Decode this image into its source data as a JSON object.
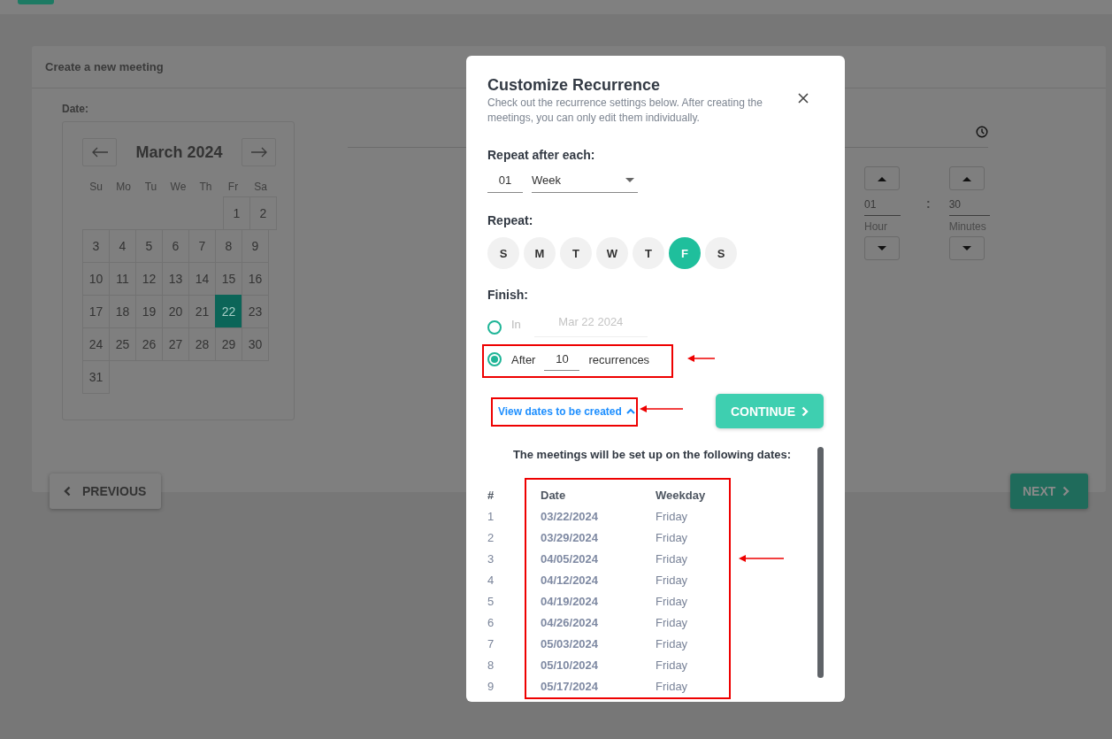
{
  "page": {
    "title": "Create a new meeting",
    "date_label": "Date:",
    "calendar": {
      "month": "March 2024",
      "weekdays": [
        "Su",
        "Mo",
        "Tu",
        "We",
        "Th",
        "Fr",
        "Sa"
      ],
      "weeks": [
        {
          "days": [
            {
              "label": "1",
              "selected": false
            },
            {
              "label": "2",
              "selected": false
            }
          ]
        },
        {
          "days": [
            {
              "label": "3",
              "selected": false
            },
            {
              "label": "4",
              "selected": false
            },
            {
              "label": "5",
              "selected": false
            },
            {
              "label": "6",
              "selected": false
            },
            {
              "label": "7",
              "selected": false
            },
            {
              "label": "8",
              "selected": false
            },
            {
              "label": "9",
              "selected": false
            }
          ]
        },
        {
          "days": [
            {
              "label": "10",
              "selected": false
            },
            {
              "label": "11",
              "selected": false
            },
            {
              "label": "12",
              "selected": false
            },
            {
              "label": "13",
              "selected": false
            },
            {
              "label": "14",
              "selected": false
            },
            {
              "label": "15",
              "selected": false
            },
            {
              "label": "16",
              "selected": false
            }
          ]
        },
        {
          "days": [
            {
              "label": "17",
              "selected": false
            },
            {
              "label": "18",
              "selected": false
            },
            {
              "label": "19",
              "selected": false
            },
            {
              "label": "20",
              "selected": false
            },
            {
              "label": "21",
              "selected": false
            },
            {
              "label": "22",
              "selected": true
            },
            {
              "label": "23",
              "selected": false
            }
          ]
        },
        {
          "days": [
            {
              "label": "24",
              "selected": false
            },
            {
              "label": "25",
              "selected": false
            },
            {
              "label": "26",
              "selected": false
            },
            {
              "label": "27",
              "selected": false
            },
            {
              "label": "28",
              "selected": false
            },
            {
              "label": "29",
              "selected": false
            },
            {
              "label": "30",
              "selected": false
            }
          ]
        },
        {
          "days": [
            {
              "label": "31",
              "selected": false
            }
          ]
        }
      ]
    },
    "time": {
      "hour": {
        "value": "01",
        "label": "Hour"
      },
      "separator": ":",
      "minutes": {
        "value": "30",
        "label": "Minutes"
      }
    },
    "previous_button": "PREVIOUS",
    "next_button": "NEXT"
  },
  "dialog": {
    "title": "Customize Recurrence",
    "description": "Check out the recurrence settings below. After creating the meetings, you can only edit them individually.",
    "interval_label": "Repeat after each:",
    "interval": {
      "value": "01",
      "unit": "Week"
    },
    "repeat_label": "Repeat:",
    "weekdays": [
      {
        "label": "S",
        "selected": false
      },
      {
        "label": "M",
        "selected": false
      },
      {
        "label": "T",
        "selected": false
      },
      {
        "label": "W",
        "selected": false
      },
      {
        "label": "T",
        "selected": false
      },
      {
        "label": "F",
        "selected": true
      },
      {
        "label": "S",
        "selected": false
      }
    ],
    "finish_label": "Finish:",
    "finish_options": [
      {
        "kind": "date",
        "label": "In",
        "value": "Mar 22 2024",
        "selected": false
      },
      {
        "kind": "count",
        "label": "After",
        "value": "10",
        "suffix": "recurrences",
        "selected": true
      }
    ],
    "view_dates_link": {
      "label": "View dates to be created",
      "expanded": true
    },
    "continue_button": "CONTINUE",
    "dates_intro": "The meetings will be set up on the following dates:",
    "columns": [
      "#",
      "Date",
      "Weekday"
    ],
    "rows": [
      {
        "n": "1",
        "date": "03/22/2024",
        "weekday": "Friday"
      },
      {
        "n": "2",
        "date": "03/29/2024",
        "weekday": "Friday"
      },
      {
        "n": "3",
        "date": "04/05/2024",
        "weekday": "Friday"
      },
      {
        "n": "4",
        "date": "04/12/2024",
        "weekday": "Friday"
      },
      {
        "n": "5",
        "date": "04/19/2024",
        "weekday": "Friday"
      },
      {
        "n": "6",
        "date": "04/26/2024",
        "weekday": "Friday"
      },
      {
        "n": "7",
        "date": "05/03/2024",
        "weekday": "Friday"
      },
      {
        "n": "8",
        "date": "05/10/2024",
        "weekday": "Friday"
      },
      {
        "n": "9",
        "date": "05/17/2024",
        "weekday": "Friday"
      }
    ]
  }
}
